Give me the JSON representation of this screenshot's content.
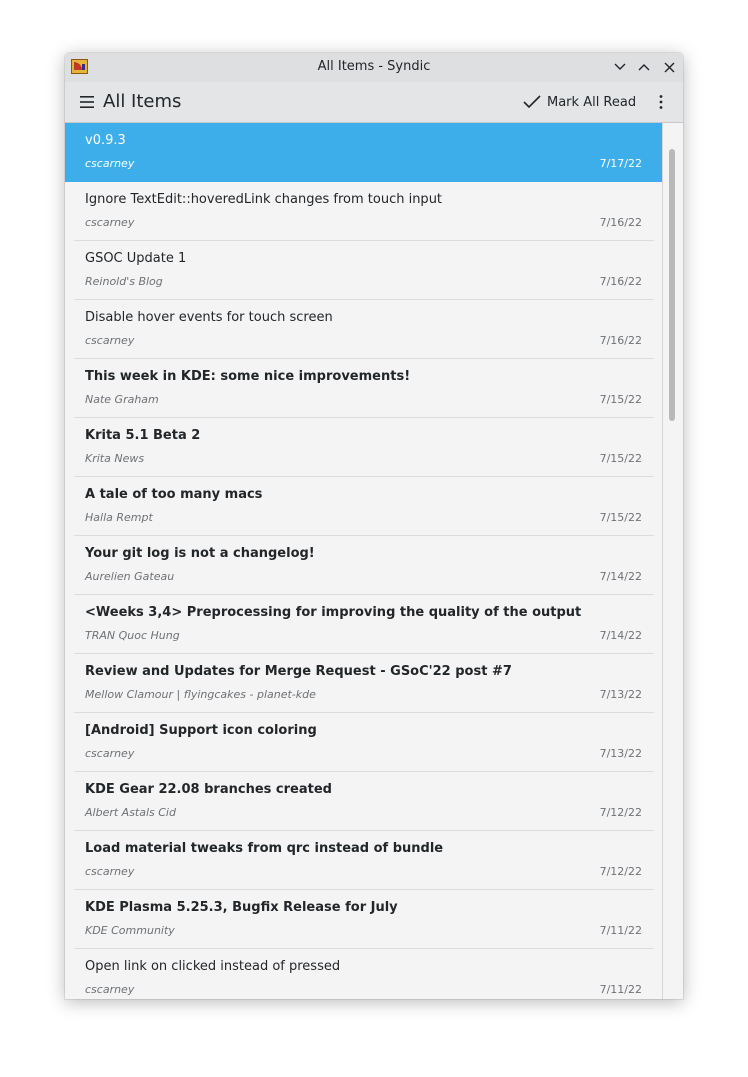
{
  "window": {
    "title": "All Items - Syndic",
    "app_icon": "rss-feed-icon",
    "controls": [
      "minimize-icon",
      "maximize-icon",
      "close-icon"
    ]
  },
  "toolbar": {
    "menu_icon": "hamburger-icon",
    "page_title": "All Items",
    "mark_all_read_label": "Mark All Read",
    "mark_all_read_icon": "checkmark-icon",
    "overflow_icon": "overflow-menu-icon"
  },
  "colors": {
    "selection": "#3daee9",
    "titlebar": "#dedfe1",
    "toolbar": "#e3e5e7",
    "list_bg": "#f4f4f5"
  },
  "items": [
    {
      "title": "v0.9.3",
      "author": "cscarney",
      "date": "7/17/22",
      "unread": false,
      "selected": true
    },
    {
      "title": "Ignore TextEdit::hoveredLink changes from touch input",
      "author": "cscarney",
      "date": "7/16/22",
      "unread": false,
      "selected": false
    },
    {
      "title": "GSOC Update 1",
      "author": "Reinold's Blog",
      "date": "7/16/22",
      "unread": false,
      "selected": false
    },
    {
      "title": "Disable hover events for touch screen",
      "author": "cscarney",
      "date": "7/16/22",
      "unread": false,
      "selected": false
    },
    {
      "title": "This week in KDE: some nice improvements!",
      "author": "Nate Graham",
      "date": "7/15/22",
      "unread": true,
      "selected": false
    },
    {
      "title": "Krita 5.1 Beta 2",
      "author": "Krita News",
      "date": "7/15/22",
      "unread": true,
      "selected": false
    },
    {
      "title": "A tale of too many macs",
      "author": "Halla Rempt",
      "date": "7/15/22",
      "unread": true,
      "selected": false
    },
    {
      "title": "Your git log is not a changelog!",
      "author": "Aurelien Gateau",
      "date": "7/14/22",
      "unread": true,
      "selected": false
    },
    {
      "title": "<Weeks 3,4> Preprocessing for improving the quality of the output",
      "author": "TRAN Quoc Hung",
      "date": "7/14/22",
      "unread": true,
      "selected": false
    },
    {
      "title": "Review and Updates for Merge Request - GSoC'22 post #7",
      "author": "Mellow Clamour | flyingcakes - planet-kde",
      "date": "7/13/22",
      "unread": true,
      "selected": false
    },
    {
      "title": "[Android] Support icon coloring",
      "author": "cscarney",
      "date": "7/13/22",
      "unread": true,
      "selected": false
    },
    {
      "title": "KDE Gear 22.08 branches created",
      "author": "Albert Astals Cid",
      "date": "7/12/22",
      "unread": true,
      "selected": false
    },
    {
      "title": "Load material tweaks from qrc instead of bundle",
      "author": "cscarney",
      "date": "7/12/22",
      "unread": true,
      "selected": false
    },
    {
      "title": "KDE Plasma 5.25.3, Bugfix Release for July",
      "author": "KDE Community",
      "date": "7/11/22",
      "unread": true,
      "selected": false
    },
    {
      "title": "Open link on clicked instead of pressed",
      "author": "cscarney",
      "date": "7/11/22",
      "unread": false,
      "selected": false
    }
  ]
}
